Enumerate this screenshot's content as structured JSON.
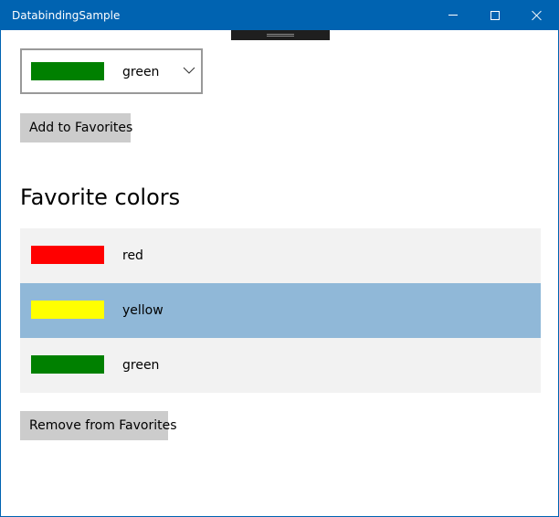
{
  "window": {
    "title": "DatabindingSample"
  },
  "combo": {
    "selected_label": "green",
    "selected_color": "#008000"
  },
  "buttons": {
    "add_label": "Add to Favorites",
    "remove_label": "Remove from Favorites"
  },
  "favorites": {
    "heading": "Favorite colors",
    "selected_index": 1,
    "items": [
      {
        "label": "red",
        "color": "#ff0000"
      },
      {
        "label": "yellow",
        "color": "#ffff00"
      },
      {
        "label": "green",
        "color": "#008000"
      }
    ]
  },
  "colors": {
    "titlebar": "#0063b1",
    "item_bg": "#f2f2f2",
    "item_selected_bg": "#90b8d8",
    "button_bg": "#cccccc"
  },
  "icons": [
    "minimize-icon",
    "maximize-icon",
    "close-icon",
    "chevron-down-icon"
  ]
}
